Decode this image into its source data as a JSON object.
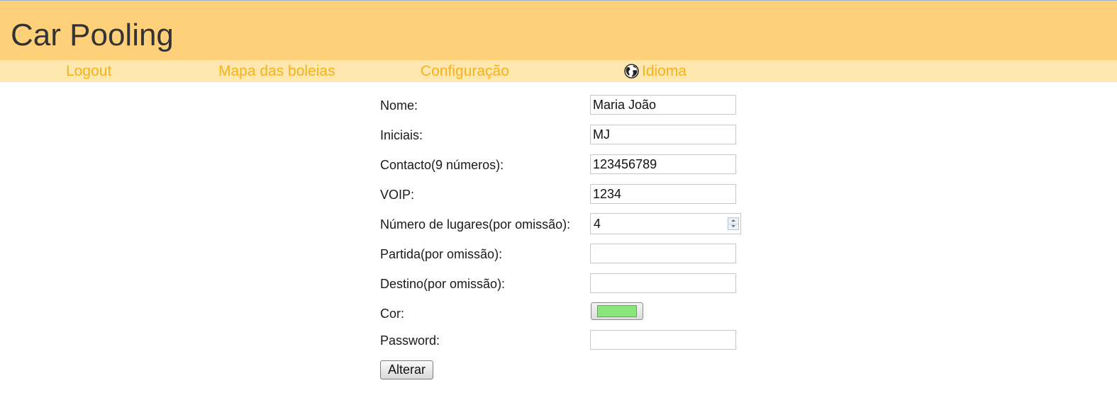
{
  "header": {
    "title": "Car Pooling"
  },
  "nav": {
    "items": [
      {
        "label": "Logout"
      },
      {
        "label": "Mapa das boleias"
      },
      {
        "label": "Configuração"
      },
      {
        "label": "Idioma",
        "icon": "globe-icon"
      }
    ]
  },
  "form": {
    "fields": {
      "name": {
        "label": "Nome:",
        "value": "Maria João"
      },
      "initials": {
        "label": "Iniciais:",
        "value": "MJ"
      },
      "contact": {
        "label": "Contacto(9 números):",
        "value": "123456789"
      },
      "voip": {
        "label": "VOIP:",
        "value": "1234"
      },
      "seats": {
        "label": "Número de lugares(por omissão):",
        "value": "4"
      },
      "departure": {
        "label": "Partida(por omissão):",
        "value": ""
      },
      "destination": {
        "label": "Destino(por omissão):",
        "value": ""
      },
      "color": {
        "label": "Cor:",
        "value": "#8ae67a"
      },
      "password": {
        "label": "Password:",
        "value": ""
      }
    },
    "submit_label": "Alterar"
  },
  "colors": {
    "header_bg": "#ffd07a",
    "nav_bg": "#ffe7b0",
    "nav_text": "#f5b21a"
  }
}
